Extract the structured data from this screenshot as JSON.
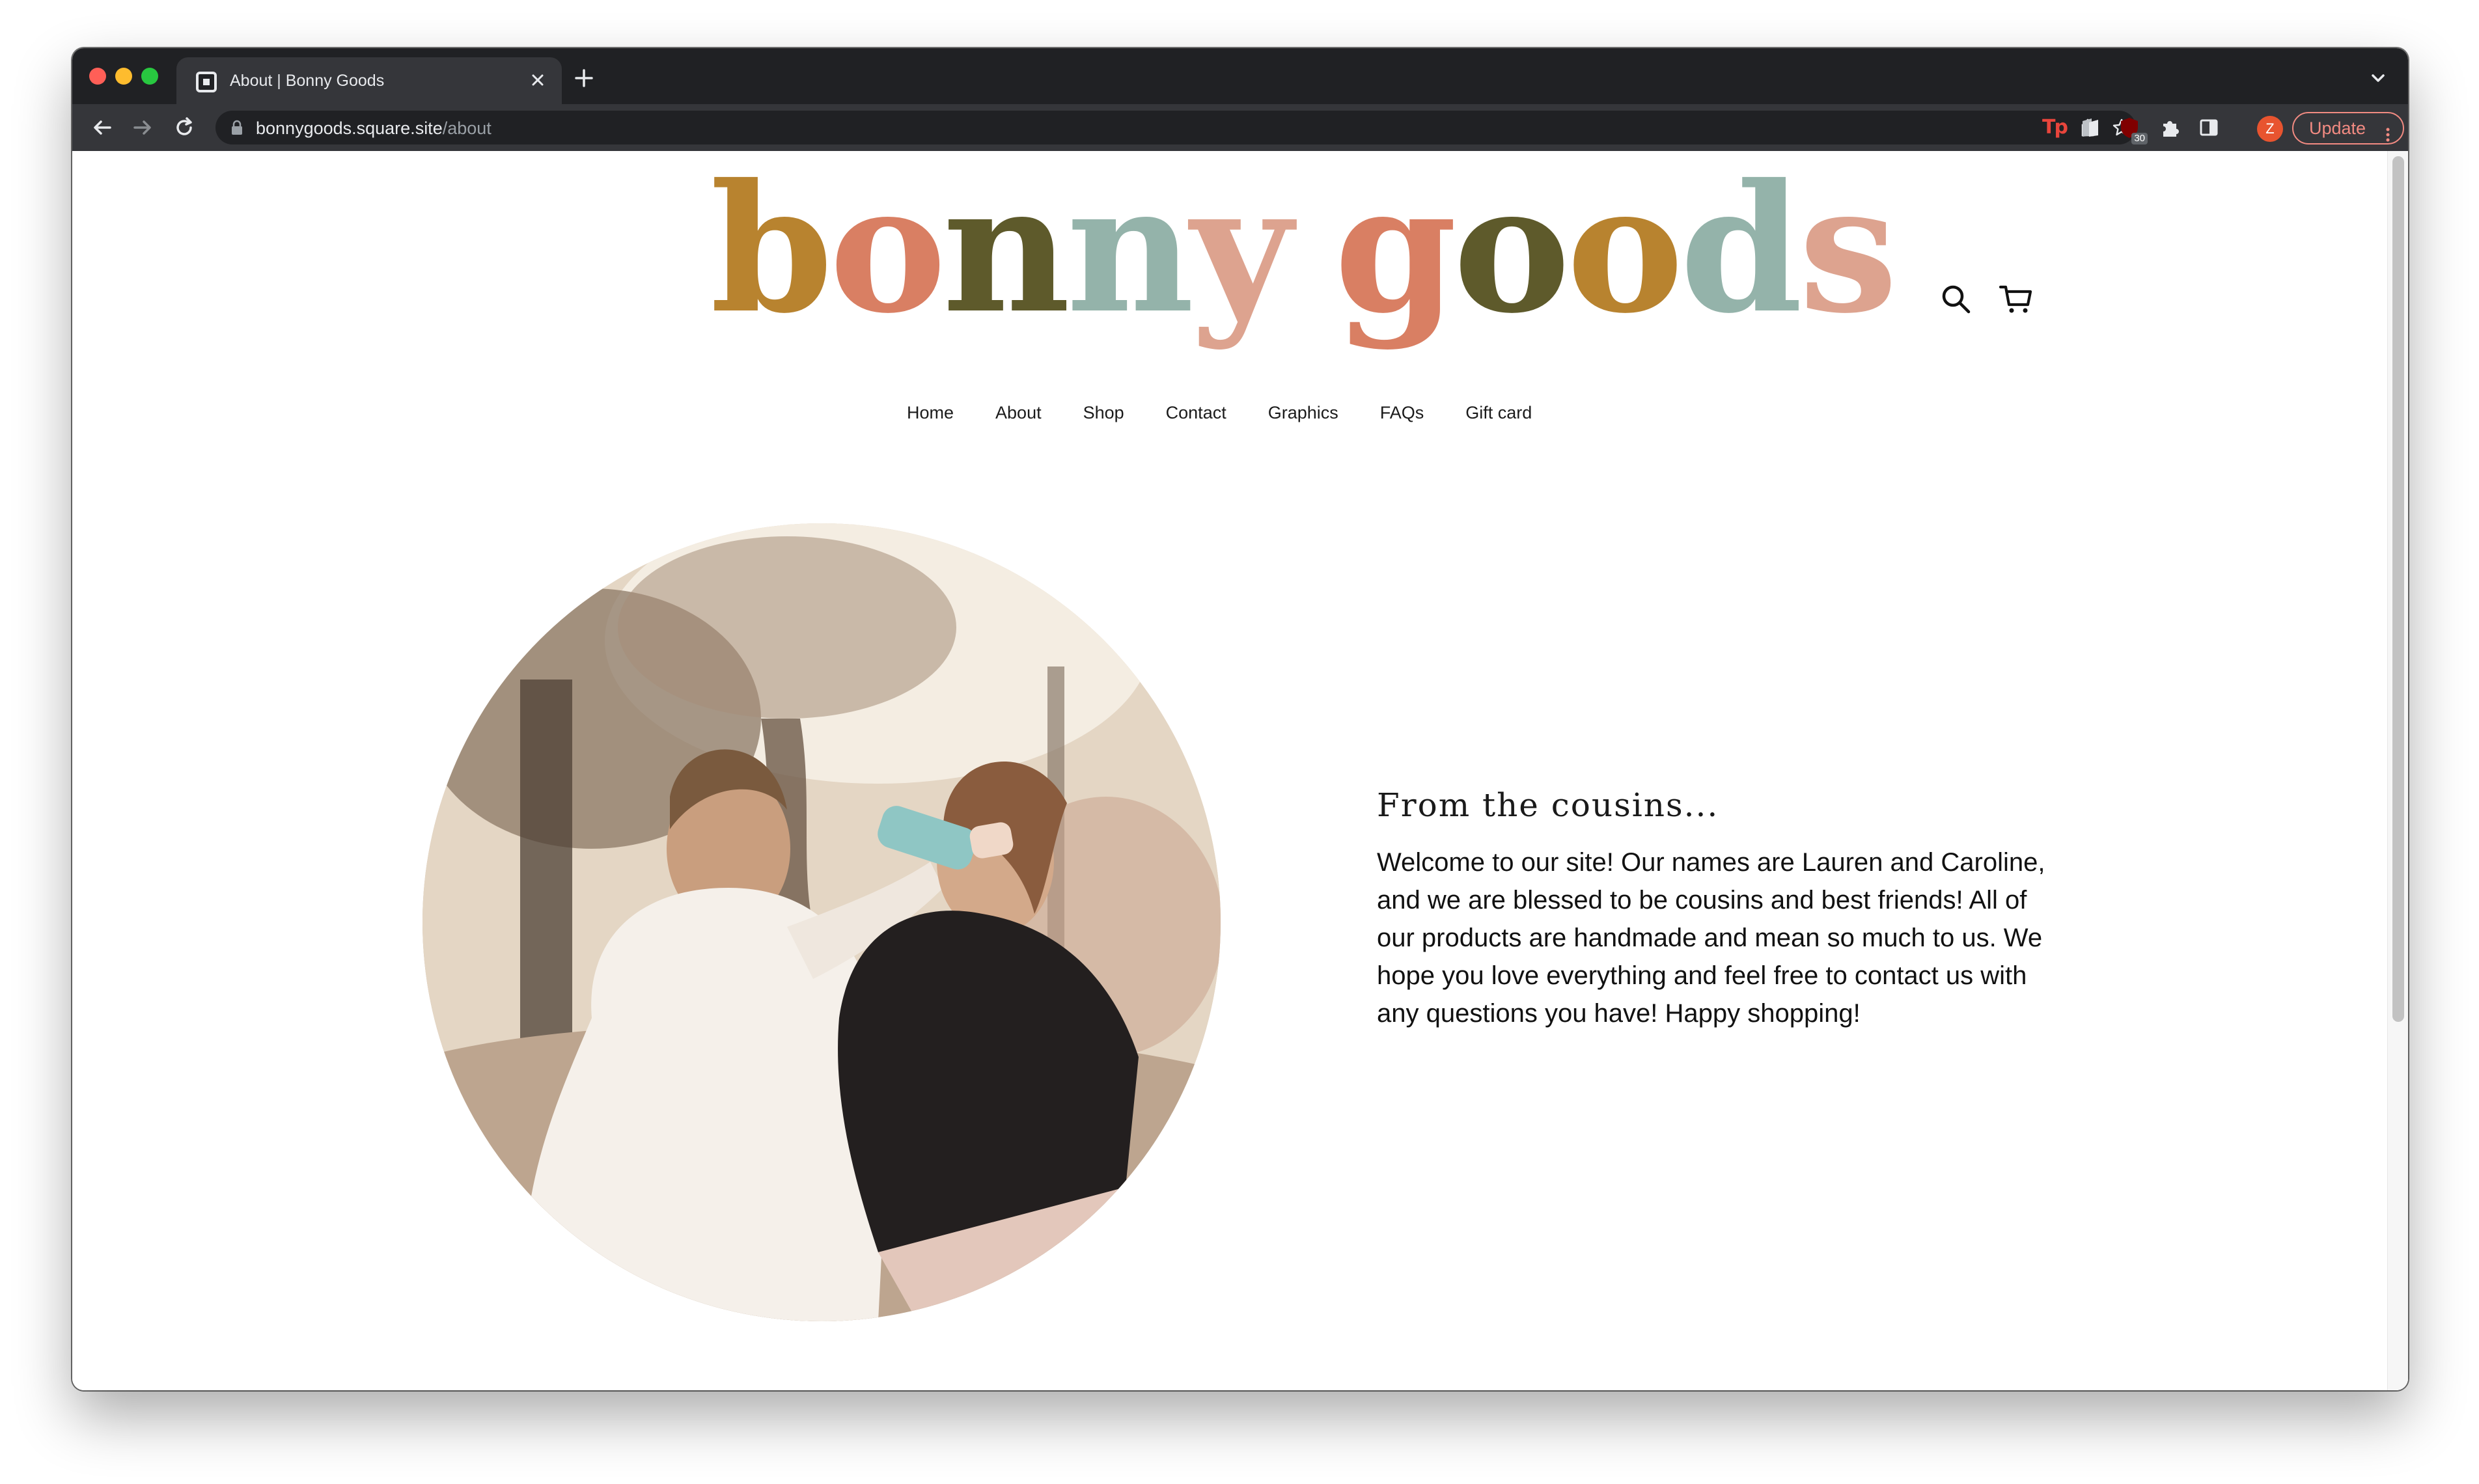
{
  "browser": {
    "tab_title": "About | Bonny Goods",
    "url_host": "bonnygoods.square.site",
    "url_path": "/about",
    "extension_badge": "30",
    "profile_initial": "Z",
    "update_label": "Update",
    "icons": [
      "close-icon",
      "plus-icon",
      "back-icon",
      "forward-icon",
      "reload-icon",
      "lock-icon",
      "share-icon",
      "star-icon",
      "puzzle-icon",
      "side-panel-icon",
      "kebab-icon",
      "chevron-down-icon"
    ]
  },
  "site": {
    "logo_word1": [
      "b",
      "o",
      "n",
      "n",
      "y"
    ],
    "logo_word2": [
      "g",
      "o",
      "o",
      "d",
      "s"
    ],
    "logo_colors": [
      "#b8832f",
      "#d97f63",
      "#5e5a2b",
      "#94b3aa",
      "#dda38f"
    ],
    "nav": [
      "Home",
      "About",
      "Shop",
      "Contact",
      "Graphics",
      "FAQs",
      "Gift card"
    ],
    "heading": "From the cousins...",
    "body": "Welcome to our site! Our names are Lauren and Caroline, and we are blessed to be cousins and best friends! All of our products are handmade and mean so much to us. We hope you love everything and feel free to contact us with any questions you have! Happy shopping!",
    "header_icons": [
      "search-icon",
      "cart-icon"
    ]
  }
}
